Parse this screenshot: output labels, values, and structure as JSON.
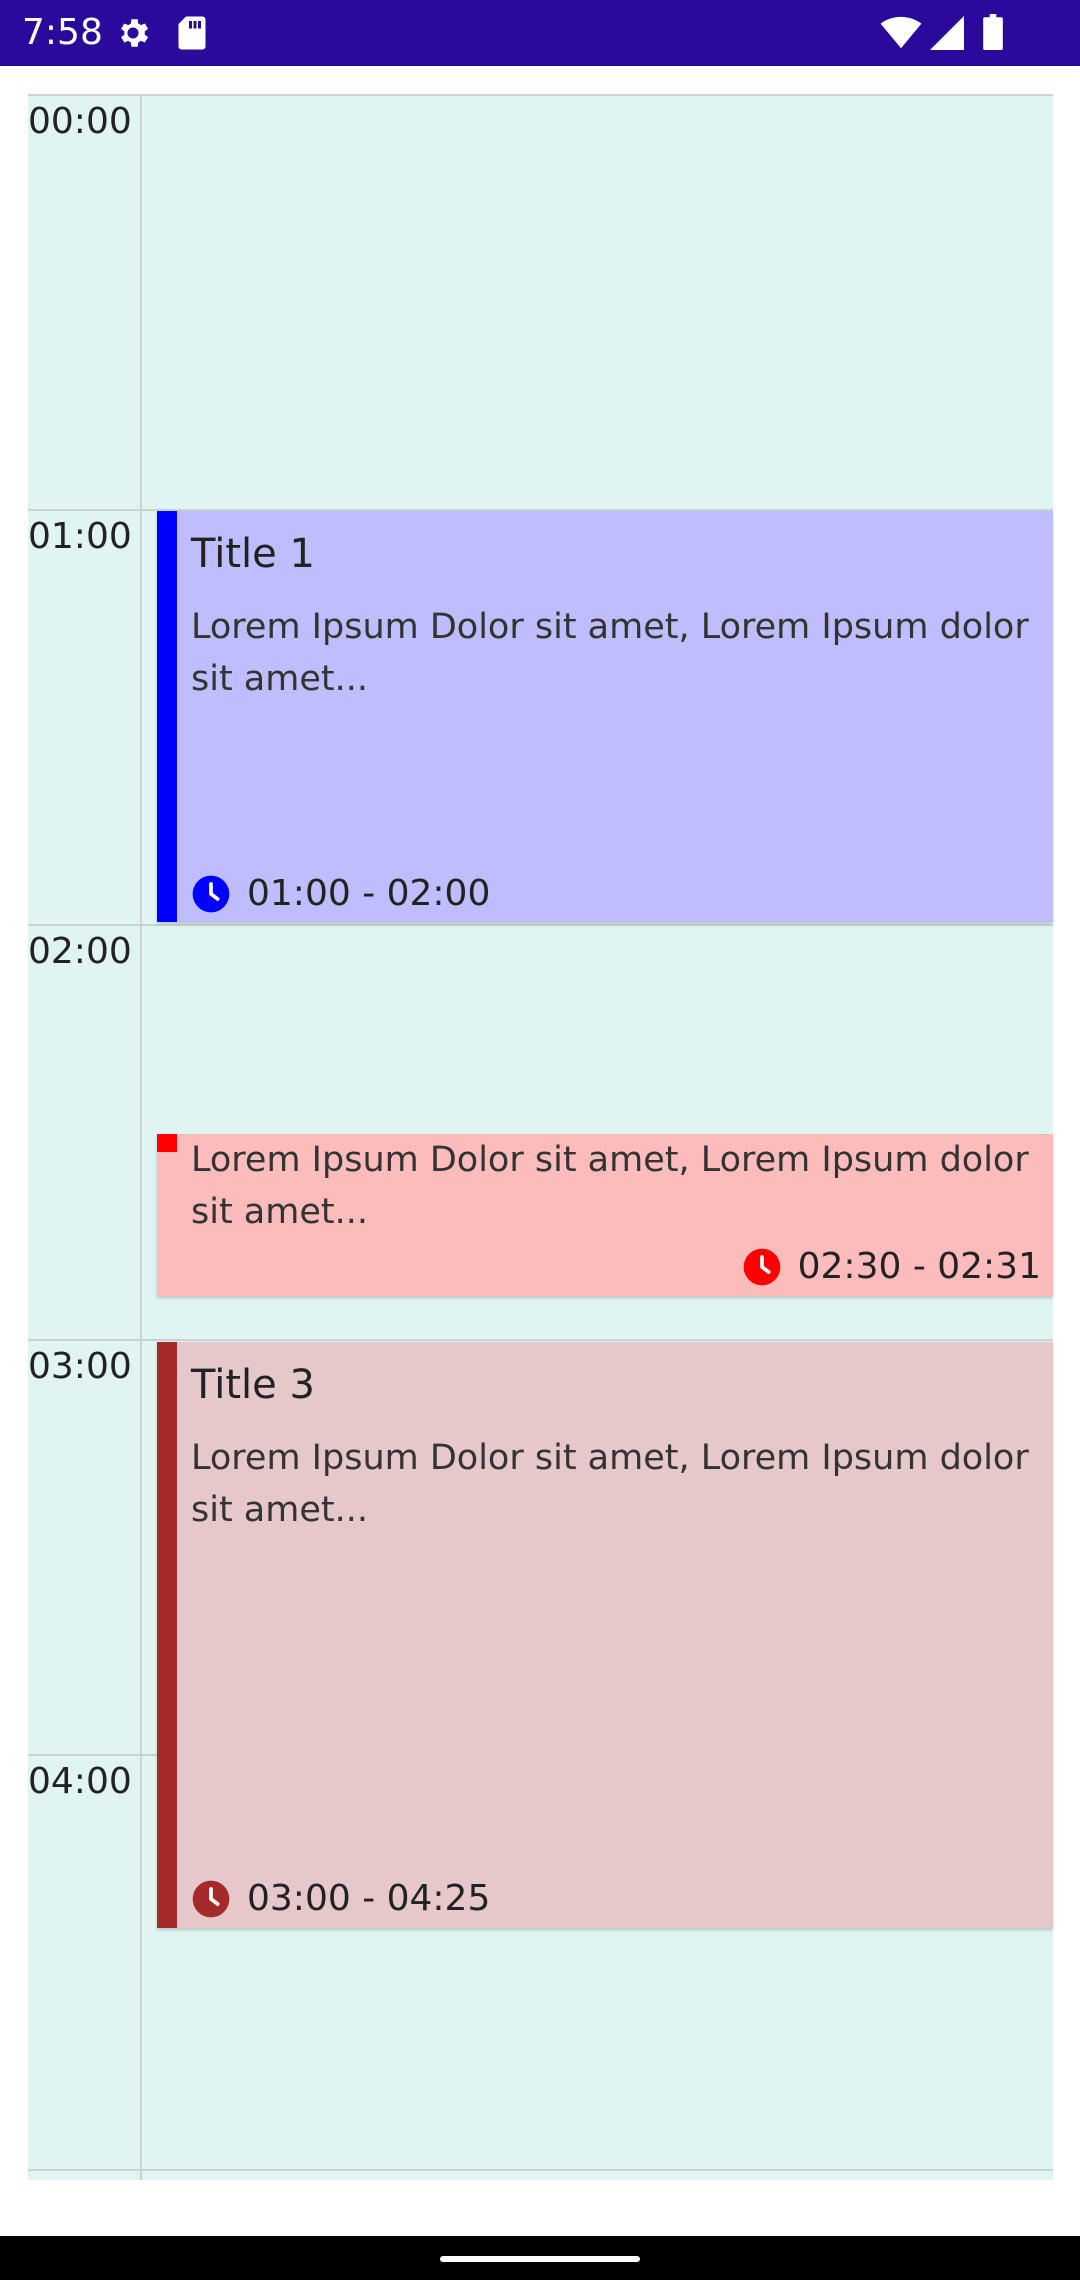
{
  "status_bar": {
    "time": "7:58",
    "icons": [
      "gear-icon",
      "sd-card-icon",
      "wifi-icon",
      "signal-icon",
      "battery-icon"
    ],
    "background": "#2a0a9a"
  },
  "calendar": {
    "background": "#e0f4f2",
    "hours": [
      "00:00",
      "01:00",
      "02:00",
      "03:00",
      "04:00"
    ],
    "events": [
      {
        "title": "Title 1",
        "description": "Lorem Ipsum Dolor sit amet, Lorem Ipsum dolor sit amet...",
        "time": "01:00 - 02:00",
        "color": "#0000ff",
        "background": "#bebdfd"
      },
      {
        "title": "",
        "description": "Lorem Ipsum Dolor sit amet, Lorem Ipsum dolor sit amet...",
        "time": "02:30 - 02:31",
        "color": "#ff0000",
        "background": "#fdbcbc"
      },
      {
        "title": "Title 3",
        "description": "Lorem Ipsum Dolor sit amet, Lorem Ipsum dolor sit amet...",
        "time": "03:00 - 04:25",
        "color": "#a52a2a",
        "background": "#e6c8ca"
      }
    ]
  },
  "nav_bar": {
    "handle": "home-handle"
  }
}
